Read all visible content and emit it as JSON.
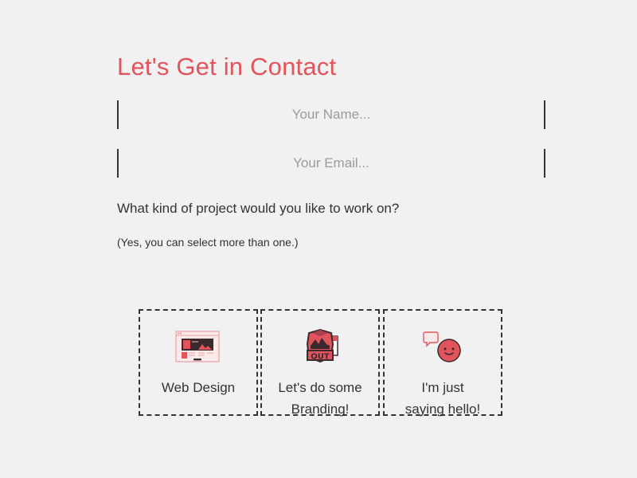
{
  "form": {
    "title": "Let's Get in Contact",
    "name_placeholder": "Your Name...",
    "email_placeholder": "Your Email...",
    "question": "What kind of project would you like to work on?",
    "hint": "(Yes, you can select more than one.)"
  },
  "options": [
    {
      "label": "Web Design",
      "icon": "website-mockup-icon"
    },
    {
      "label_line1": "Let's do some",
      "label_line2": "Branding!",
      "icon": "branding-badge-icon"
    },
    {
      "label_line1": "I'm just",
      "label_line2": "saying hello!",
      "icon": "smiley-chat-icon"
    }
  ],
  "colors": {
    "accent": "#e2545b",
    "text": "#333333",
    "placeholder": "#9b9b9b",
    "background": "#f2f1f1"
  }
}
